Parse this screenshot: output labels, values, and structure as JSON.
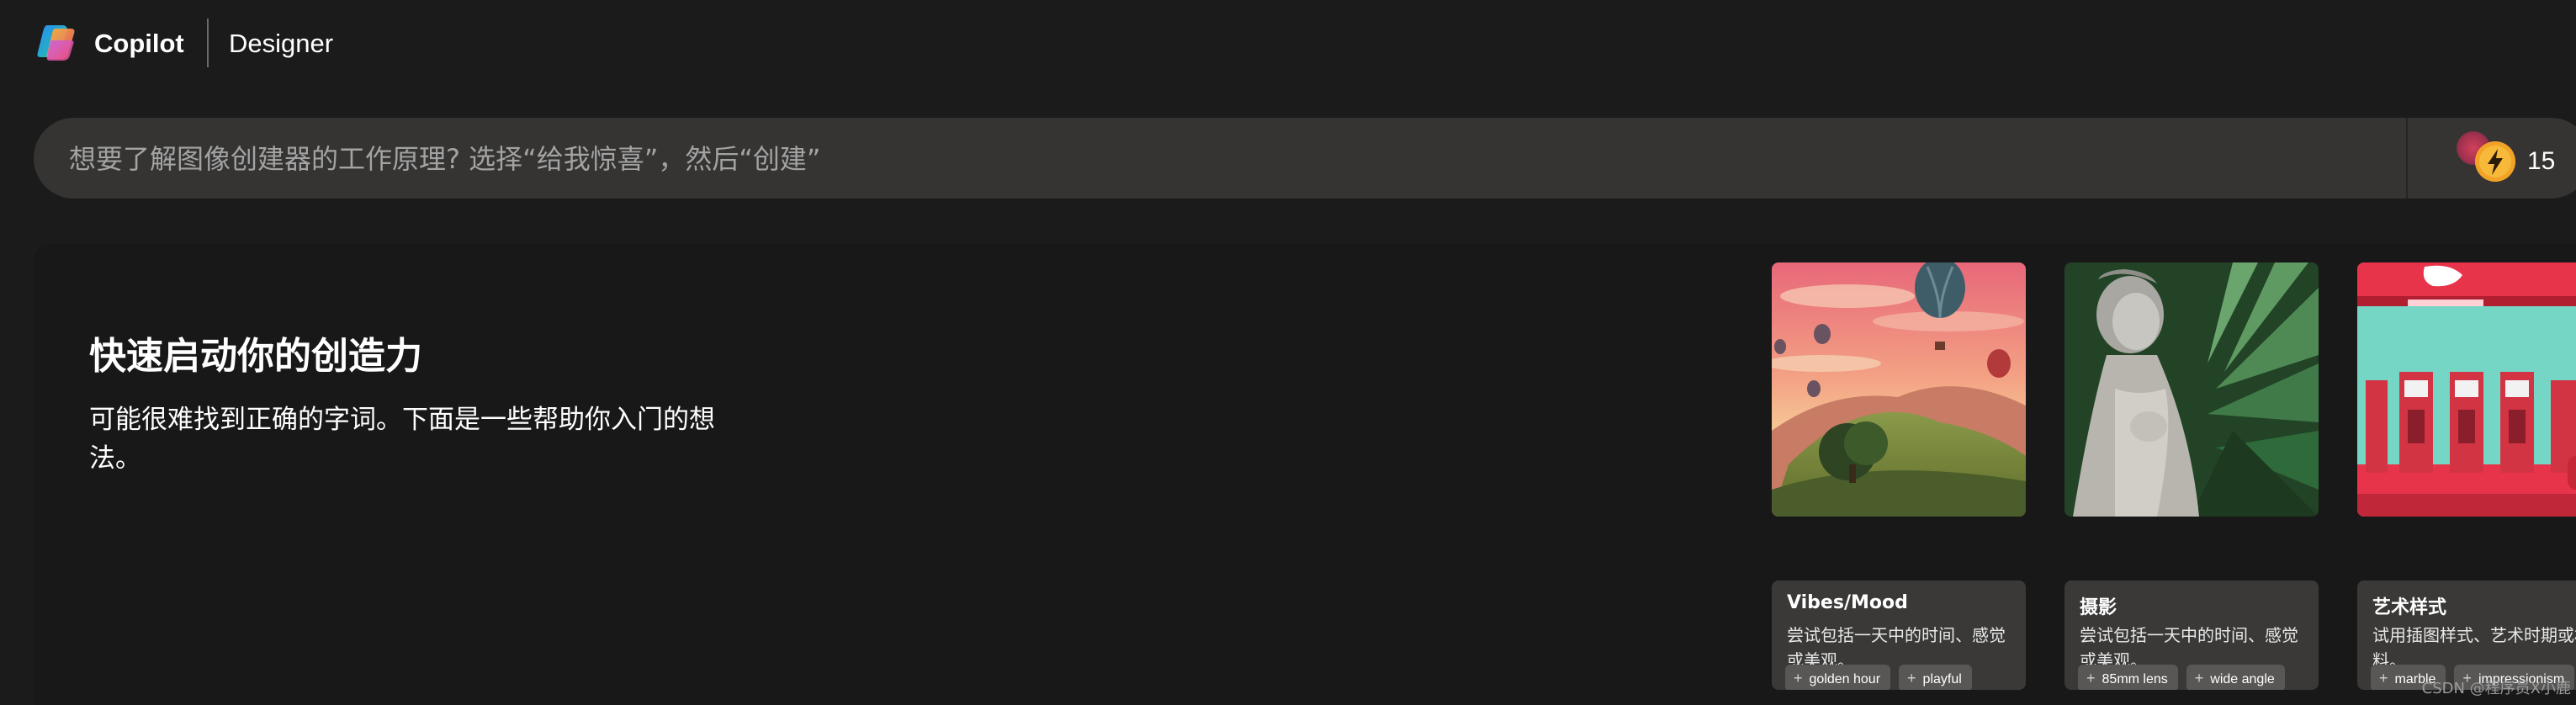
{
  "header": {
    "brand": "Copilot",
    "product": "Designer",
    "logo_icon": "copilot-logo"
  },
  "prompt": {
    "placeholder": "想要了解图像创建器的工作原理? 选择“给我惊喜”，然后“创建”",
    "value": "",
    "boost_icon": "lightning-coin-icon",
    "boost_count": "15"
  },
  "intro": {
    "title": "快速启动你的创造力",
    "description": "可能很难找到正确的字词。下面是一些帮助你入门的想法。"
  },
  "cards": [
    {
      "title": "Vibes/Mood",
      "description": "尝试包括一天中的时间、感觉或美观。",
      "image_subject": "hot-air-balloons-sunset-landscape",
      "tags": [
        "golden hour",
        "playful"
      ]
    },
    {
      "title": "摄影",
      "description": "尝试包括一天中的时间、感觉或美观。",
      "image_subject": "marble-statue-palm-leaves",
      "tags": [
        "85mm lens",
        "wide angle"
      ]
    },
    {
      "title": "艺术样式",
      "description": "试用插图样式、艺术时期或材料。",
      "image_subject": "red-gas-station-pumps",
      "tags": [
        "marble",
        "impressionism"
      ]
    }
  ],
  "watermark": "CSDN @程序员X小鹿",
  "colors": {
    "background": "#1c1b1b",
    "panel": "#181818",
    "prompt_bar": "#353433",
    "card_body": "#3a3938",
    "tag": "#585756"
  }
}
